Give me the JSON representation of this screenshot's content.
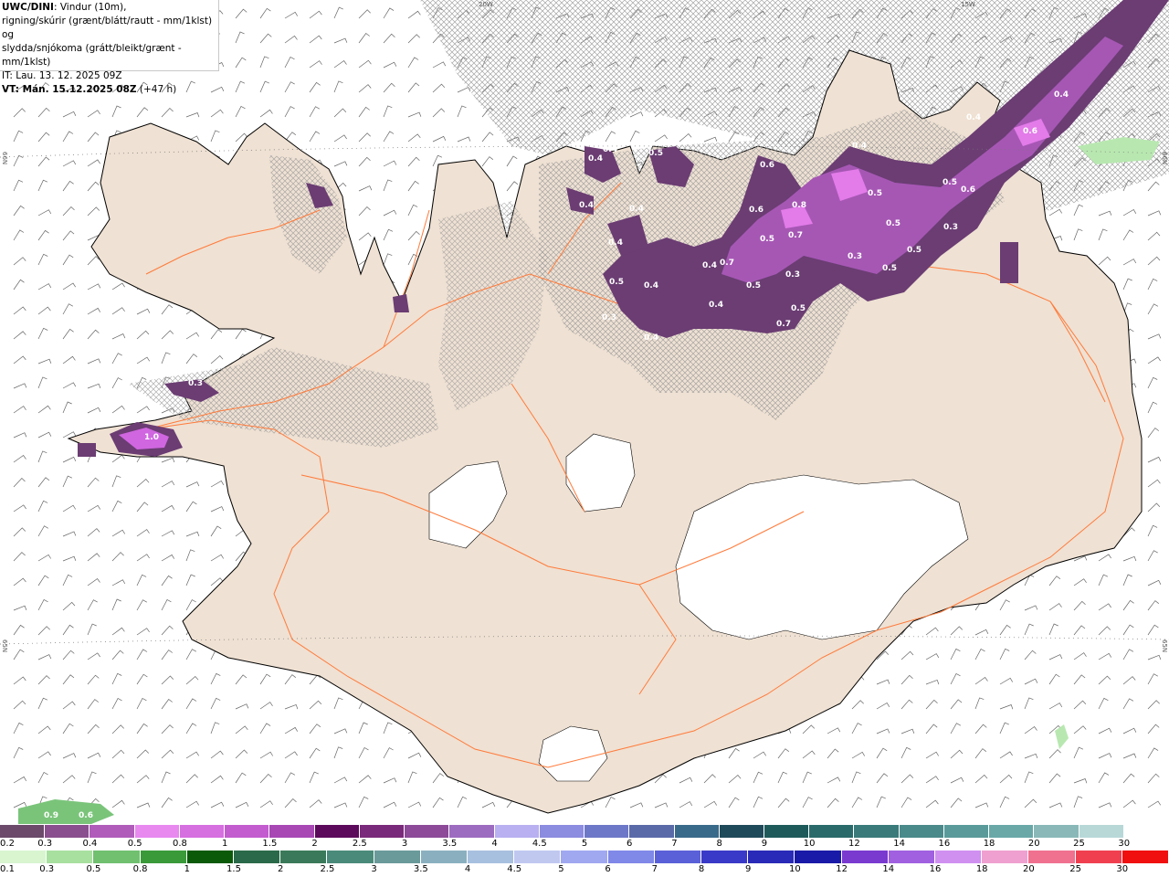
{
  "info": {
    "model": "UWC/DINI",
    "line1_rest": ": Vindur (10m),",
    "line2": "rigning/skúrir (grænt/blátt/rautt - mm/1klst) og",
    "line3": "slydda/snjókoma (grátt/bleikt/grænt - mm/1klst)",
    "line4": "IT: Lau. 13. 12. 2025 09Z",
    "line5_bold": "VT: Mán. 15.12.2025 08Z",
    "line5_rest": " (+47 h)"
  },
  "grid_labels": {
    "lon_20w": "20W",
    "lon_15w": "15W",
    "lat_66n_left": "66N",
    "lat_66n_right": "66N",
    "lat_65n_left": "65N",
    "lat_65n_right": "65N"
  },
  "map_values": [
    "0.4",
    "0.5",
    "0.4",
    "0.6",
    "0.8",
    "0.5",
    "0.6",
    "0.4",
    "0.3",
    "0.6",
    "0.4",
    "0.5",
    "0.7",
    "0.5",
    "0.4",
    "0.4",
    "0.6",
    "0.7",
    "0.5",
    "0.3",
    "0.5",
    "0.5",
    "0.4",
    "0.5",
    "0.3",
    "0.4",
    "0.5",
    "0.3",
    "1.0",
    "0.3",
    "0.9",
    "0.6",
    "0.4",
    "0.4",
    "0.5",
    "0.7",
    "0.4",
    "0.4"
  ],
  "snow_scale": {
    "labels": [
      "0.2",
      "0.3",
      "0.4",
      "0.5",
      "0.8",
      "1",
      "1.5",
      "2",
      "2.5",
      "3",
      "3.5",
      "4",
      "4.5",
      "5",
      "6",
      "7",
      "8",
      "9",
      "10",
      "12",
      "14",
      "16",
      "18",
      "20",
      "25",
      "30"
    ],
    "colors": [
      "#6b4a6b",
      "#8a4f8e",
      "#b05cba",
      "#e889f0",
      "#d66fe0",
      "#c35ccf",
      "#a848b5",
      "#5c0a5c",
      "#7a2a7a",
      "#8c4a98",
      "#9c6cc0",
      "#b8b0f0",
      "#8c8ce0",
      "#6e78c8",
      "#5a6aa8",
      "#3a6a8a",
      "#1f4a5a",
      "#1e5a5a",
      "#2a6a6a",
      "#3a7a7a",
      "#4a8a8a",
      "#5a9a9a",
      "#6aa8a8",
      "#8ab8b8",
      "#b8d8d8",
      "#ffffff"
    ]
  },
  "rain_scale": {
    "labels": [
      "0.1",
      "0.3",
      "0.5",
      "0.8",
      "1",
      "1.5",
      "2",
      "2.5",
      "3",
      "3.5",
      "4",
      "4.5",
      "5",
      "6",
      "7",
      "8",
      "9",
      "10",
      "12",
      "14",
      "16",
      "18",
      "20",
      "25",
      "30"
    ],
    "colors": [
      "#d8f5d0",
      "#a8e0a0",
      "#70c070",
      "#3a9a3a",
      "#0a5a0a",
      "#2a6a4a",
      "#3a7a5a",
      "#4a8a7a",
      "#6a9a9a",
      "#8ab0c0",
      "#a8c0e0",
      "#c0c8f0",
      "#a0a8f0",
      "#8088e8",
      "#5a60d8",
      "#3a3ac8",
      "#2a2ab8",
      "#1a1aa8",
      "#7a3ad0",
      "#a060e0",
      "#d090f0",
      "#f0a0d0",
      "#f07090",
      "#f04050",
      "#f01010"
    ]
  },
  "colors": {
    "land": "#efe1d3",
    "glacier": "#ffffff",
    "sea": "#ffffff",
    "roads": "#ff7a3a",
    "coast": "#000000",
    "wind_barb": "#555555",
    "hatch": "#9a9a9a"
  }
}
